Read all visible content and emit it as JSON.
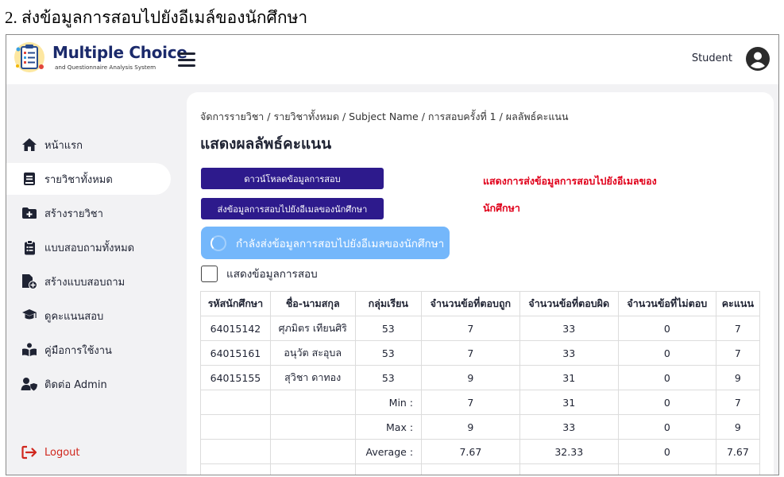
{
  "doc": {
    "caption": "2.  ส่งข้อมูลการสอบไปยังอีเมล์ของนักศึกษา"
  },
  "header": {
    "brand_title": "Multiple Choice",
    "brand_subtitle": "and Questionnaire Analysis System",
    "user_name": "Student"
  },
  "sidebar": {
    "items": [
      {
        "label": "หน้าแรก",
        "icon": "home-icon"
      },
      {
        "label": "รายวิชาทั้งหมด",
        "icon": "book-icon"
      },
      {
        "label": "สร้างรายวิชา",
        "icon": "folder-plus-icon"
      },
      {
        "label": "แบบสอบถามทั้งหมด",
        "icon": "clipboard-list-icon"
      },
      {
        "label": "สร้างแบบสอบถาม",
        "icon": "file-plus-icon"
      },
      {
        "label": "ดูคะแนนสอบ",
        "icon": "graduation-cap-icon"
      },
      {
        "label": "คู่มือการใช้งาน",
        "icon": "book-reader-icon"
      },
      {
        "label": "ติดต่อ Admin",
        "icon": "user-shield-icon"
      }
    ],
    "logout_label": "Logout"
  },
  "main": {
    "breadcrumb": "จัดการรายวิชา / รายวิชาทั้งหมด / Subject Name / การสอบครั้งที่ 1 / ผลลัพธ์คะแนน",
    "title": "แสดงผลลัพธ์คะแนน",
    "download_button": "ดาวน์โหลดข้อมูลการสอบ",
    "send_email_button": "ส่งข้อมูลการสอบไปยังอีเมลของนักศึกษา",
    "sending_button": "กำลังส่งข้อมูลการสอบไปยังอีเมลของนักศึกษา",
    "annotation_line1": "แสดงการส่งข้อมูลการสอบไปยังอีเมลของ",
    "annotation_line2": "นักศึกษา",
    "show_data_label": "แสดงข้อมูลการสอบ",
    "table": {
      "headers": [
        "รหัสนักศึกษา",
        "ชื่อ-นามสกุล",
        "กลุ่มเรียน",
        "จำนวนข้อที่ตอบถูก",
        "จำนวนข้อที่ตอบผิด",
        "จำนวนข้อที่ไม่ตอบ",
        "คะแนน"
      ],
      "rows": [
        [
          "64015142",
          "ศุภมิตร เทียนศิริ",
          "53",
          "7",
          "33",
          "0",
          "7"
        ],
        [
          "64015161",
          "อนุวัต สะอุบล",
          "53",
          "7",
          "33",
          "0",
          "7"
        ],
        [
          "64015155",
          "สุวิชา ดาทอง",
          "53",
          "9",
          "31",
          "0",
          "9"
        ]
      ],
      "stats": [
        [
          "Min :",
          "7",
          "31",
          "0",
          "7"
        ],
        [
          "Max :",
          "9",
          "33",
          "0",
          "9"
        ],
        [
          "Average :",
          "7.67",
          "32.33",
          "0",
          "7.67"
        ]
      ]
    }
  },
  "colors": {
    "primary_button": "#2d1a8c",
    "loading_button": "#74b7fb",
    "annotation": "#e0001a",
    "logout": "#d0271d",
    "brand": "#1b2a6b"
  }
}
